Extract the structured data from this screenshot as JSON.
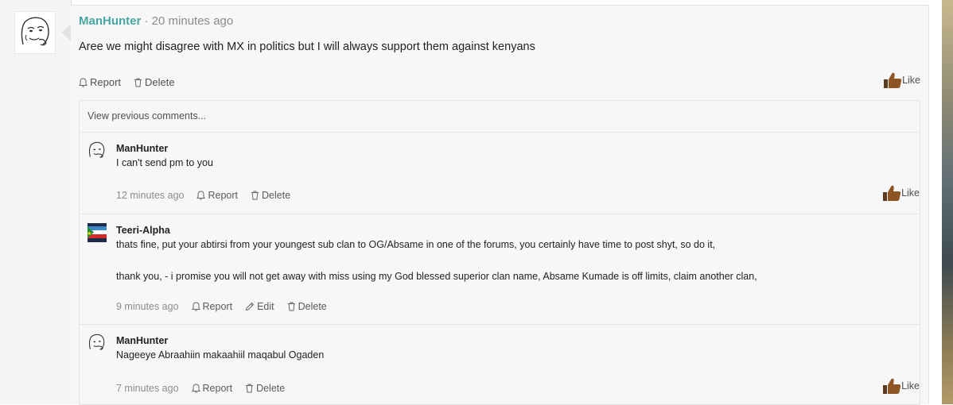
{
  "post": {
    "username": "ManHunter",
    "time": " · 20 minutes ago",
    "body": "Aree we might disagree with MX in politics but I will always support them against kenyans",
    "actions": {
      "report": "Report",
      "delete": "Delete"
    },
    "like": "Like"
  },
  "comments": {
    "view_previous": "View previous comments...",
    "items": [
      {
        "username": "ManHunter",
        "text": "I can't send pm to you",
        "time": "12 minutes ago",
        "report": "Report",
        "delete": "Delete",
        "like": "Like"
      },
      {
        "username": "Teeri-Alpha",
        "text": "thats fine, put your abtirsi from your youngest sub clan to OG/Absame in one of the forums, you certainly have time to post shyt, so do it,",
        "text2": "thank you, - i promise you will not get away with miss using my God blessed superior clan name, Absame Kumade is off limits, claim another clan,",
        "time": "9 minutes ago",
        "report": "Report",
        "edit": "Edit",
        "delete": "Delete"
      },
      {
        "username": "ManHunter",
        "text": "Nageeye Abraahiin makaahiil maqabul Ogaden",
        "time": "7 minutes ago",
        "report": "Report",
        "delete": "Delete",
        "like": "Like"
      }
    ]
  },
  "colors": {
    "username_accent": "#47a7a2",
    "like_thumb": "#8d5524"
  },
  "icons": [
    "meme-face-avatar",
    "bell-icon",
    "trash-icon",
    "pencil-icon",
    "thumbs-up-icon",
    "flag-avatar"
  ]
}
